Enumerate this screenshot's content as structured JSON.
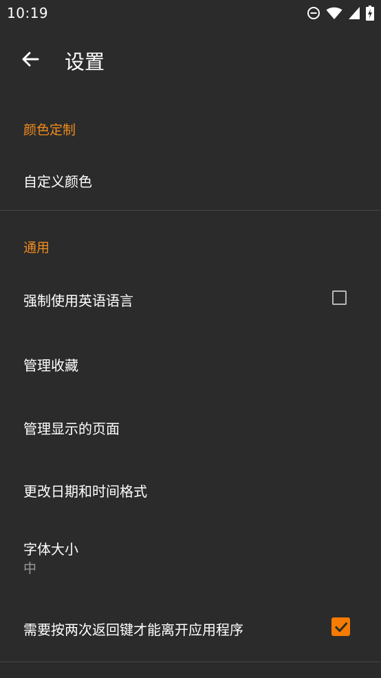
{
  "status_bar": {
    "time": "10:19",
    "icons": [
      "do-not-disturb-icon",
      "wifi-icon",
      "cell-signal-icon",
      "battery-charging-icon"
    ]
  },
  "app_bar": {
    "back_icon": "arrow-left-icon",
    "title": "设置"
  },
  "sections": [
    {
      "header": "颜色定制",
      "items": [
        {
          "title": "自定义颜色"
        }
      ]
    },
    {
      "header": "通用",
      "items": [
        {
          "title": "强制使用英语语言",
          "checkbox": false
        },
        {
          "title": "管理收藏"
        },
        {
          "title": "管理显示的页面"
        },
        {
          "title": "更改日期和时间格式"
        },
        {
          "title": "字体大小",
          "summary": "中"
        },
        {
          "title": "需要按两次返回键才能离开应用程序",
          "checkbox": true
        }
      ]
    }
  ],
  "colors": {
    "background": "#2b2b2b",
    "accent": "#f08c1e",
    "checkbox_checked": "#f57c00",
    "divider": "#454545"
  }
}
